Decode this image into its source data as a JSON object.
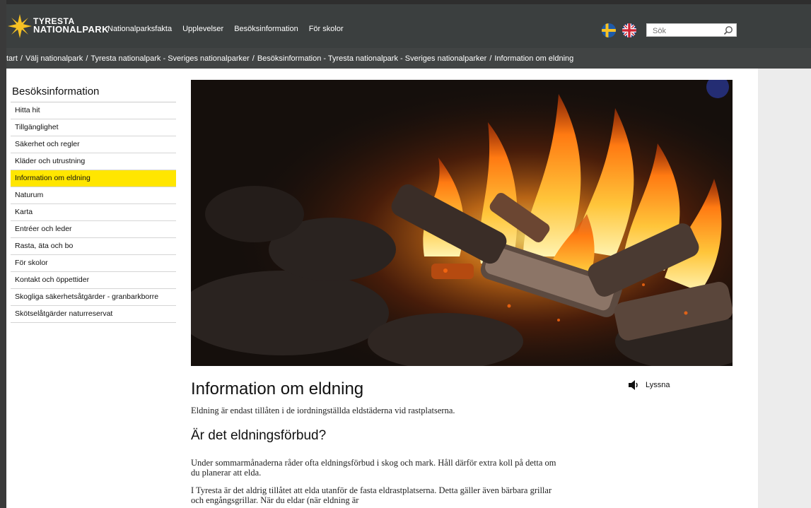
{
  "header": {
    "logo_line1": "TYRESTA",
    "logo_line2": "NATIONALPARK",
    "nav": [
      "Nationalparksfakta",
      "Upplevelser",
      "Besöksinformation",
      "För skolor"
    ],
    "search_placeholder": "Sök"
  },
  "breadcrumb": [
    "tart",
    "Välj nationalpark",
    "Tyresta nationalpark - Sveriges nationalparker",
    "Besöksinformation - Tyresta nationalpark - Sveriges nationalparker",
    "Information om eldning"
  ],
  "sidebar": {
    "title": "Besöksinformation",
    "items": [
      {
        "label": "Hitta hit"
      },
      {
        "label": "Tillgänglighet"
      },
      {
        "label": "Säkerhet och regler"
      },
      {
        "label": "Kläder och utrustning"
      },
      {
        "label": "Information om eldning",
        "active": true
      },
      {
        "label": "Naturum"
      },
      {
        "label": "Karta"
      },
      {
        "label": "Entréer och leder"
      },
      {
        "label": "Rasta, äta och bo"
      },
      {
        "label": "För skolor"
      },
      {
        "label": "Kontakt och öppettider"
      },
      {
        "label": "Skogliga säkerhetsåtgärder - granbarkborre"
      },
      {
        "label": "Skötselåtgärder naturreservat"
      }
    ]
  },
  "listen_label": "Lyssna",
  "content": {
    "title": "Information om eldning",
    "intro": "Eldning är endast tillåten i de iordningställda eldstäderna vid rastplatserna.",
    "subheading": "Är det eldningsförbud?",
    "para1": "Under sommarmånaderna råder ofta eldningsförbud i skog och mark. Håll därför extra koll på detta om du planerar att elda.",
    "para2": "I Tyresta är det aldrig tillåtet att elda utanför de fasta eldrastplatserna. Detta gäller även bärbara grillar och engångsgrillar. När du eldar (när eldning är"
  },
  "colors": {
    "header_bg": "#3b3f3f",
    "breadcrumb_bg": "#414444",
    "active_item": "#ffe600",
    "logo_yellow": "#f7c224"
  }
}
